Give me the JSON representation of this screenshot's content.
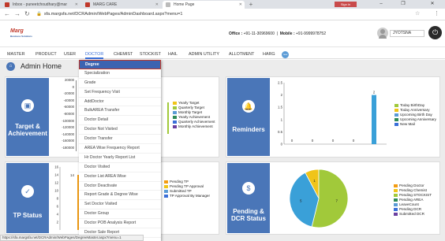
{
  "browser": {
    "tabs": [
      {
        "label": "Inbox - puneetchoudhary@mar",
        "icon_color": "#c0392b"
      },
      {
        "label": "MARG CARE",
        "icon_color": "#c0392b"
      },
      {
        "label": "Home Page",
        "icon_color": "#999999"
      }
    ],
    "new_tab": "+",
    "signin": "Sign in",
    "url": "sfa.margsfa.net/DCRAdmin/WebPages/AdminDashboard.aspx?menu=1"
  },
  "header": {
    "logo": "Marg",
    "logo_sub": "Business Solutions",
    "office_label": "Office :",
    "office_phone": "+91-11-30969600",
    "mobile_label": "Mobile :",
    "mobile_phone": "+91-9999978752",
    "username": "JYOTSNA"
  },
  "menu": [
    "MASTER",
    "PRODUCT",
    "USER",
    "DOCTOR",
    "CHEMIST",
    "STOCKIST",
    "HAIL",
    "ADMIN UTILITY",
    "ALLOTMENT",
    "HARG"
  ],
  "new_badge": "new",
  "page": {
    "title": "Admin Home"
  },
  "dropdown": [
    "Degree",
    "Specialization",
    "Grade",
    "Set Frequency Visit",
    "AddDoctor",
    "BulkAREA Transfer",
    "Doctor Detail",
    "Doctor Not Visited",
    "Doctor Transfer",
    "AREA Wise Frequency Report",
    "Hr Doctor Yearly Report List",
    "Doctor Visited",
    "Doctor List AREA Wise",
    "Doctor Deactivate",
    "Report Grade & Degree Wise",
    "Set Doctor Visited",
    "Doctor Group",
    "Doctor POB Analysis Report",
    "Doctor Sale Report"
  ],
  "target": {
    "title": "Target &",
    "title2": "Achievement",
    "y_ticks": [
      "20000",
      "0",
      "-20000",
      "-40000",
      "-60000",
      "-80000",
      "-100000",
      "-120000",
      "-140000",
      "-160000",
      "-180000"
    ],
    "legend": [
      {
        "label": "Yearly Target",
        "color": "#f0c419"
      },
      {
        "label": "Quarterly Target",
        "color": "#a1c93a"
      },
      {
        "label": "Monthly Target",
        "color": "#5b9bd5"
      },
      {
        "label": "Yearly Achievement",
        "color": "#2e8b57"
      },
      {
        "label": "Quarterly Achievement",
        "color": "#3a6fd8"
      },
      {
        "label": "Monthly Achievement",
        "color": "#6b3fa0"
      }
    ]
  },
  "reminders": {
    "title": "Reminders",
    "y_ticks": [
      "2.5",
      "2",
      "1.5",
      "1",
      "0.5",
      "0"
    ],
    "bar_value_label": "2",
    "zero_labels": [
      "0",
      "0",
      "0",
      "0"
    ],
    "legend": [
      {
        "label": "Today BirthDay",
        "color": "#a1c93a"
      },
      {
        "label": "Today Anniversary",
        "color": "#f0c419"
      },
      {
        "label": "Upcoming Birth Day",
        "color": "#5b9bd5"
      },
      {
        "label": "Upcoming Anniversary",
        "color": "#2e8b57"
      },
      {
        "label": "New Mail",
        "color": "#3a6fd8"
      }
    ]
  },
  "tp": {
    "title": "TP Status",
    "y_ticks": [
      "16",
      "14",
      "12",
      "10",
      "8",
      "6",
      "4",
      "2"
    ],
    "bar_value_label": "14",
    "legend": [
      {
        "label": "Pending TP",
        "color": "#f39c12"
      },
      {
        "label": "Pending TP Approval",
        "color": "#f0c419"
      },
      {
        "label": "Submitted TP",
        "color": "#5b9bd5"
      },
      {
        "label": "TP Approval By Manager",
        "color": "#3a6fd8"
      }
    ]
  },
  "pending": {
    "title": "Pending &",
    "title2": "DCR Status",
    "slice_labels": [
      "7",
      "5",
      "1"
    ],
    "legend": [
      {
        "label": "Pending Doctor",
        "color": "#f39c12"
      },
      {
        "label": "Pending Chemist",
        "color": "#f0c419"
      },
      {
        "label": "Pending STOCKIST",
        "color": "#a1c93a"
      },
      {
        "label": "Pending AREA",
        "color": "#2e8b57"
      },
      {
        "label": "LeaveCount",
        "color": "#5b9bd5"
      },
      {
        "label": "Pending DCR",
        "color": "#3a6fd8"
      },
      {
        "label": "Submitted DCR",
        "color": "#6b3fa0"
      }
    ]
  },
  "chart_data": [
    {
      "type": "bar",
      "title": "Reminders",
      "categories": [
        "Today BirthDay",
        "Today Anniversary",
        "Upcoming Birth Day",
        "Upcoming Anniversary",
        "New Mail"
      ],
      "values": [
        0,
        0,
        0,
        0,
        2
      ],
      "ylim": [
        0,
        2.5
      ]
    },
    {
      "type": "bar",
      "title": "TP Status",
      "series": [
        {
          "name": "Pending TP",
          "values": [
            14
          ]
        }
      ],
      "ylim": [
        0,
        16
      ]
    },
    {
      "type": "pie",
      "title": "Pending & DCR Status",
      "series": [
        {
          "name": "Pending STOCKIST",
          "values": [
            1
          ]
        },
        {
          "name": "Pending AREA",
          "values": [
            7
          ]
        },
        {
          "name": "LeaveCount",
          "values": [
            5
          ]
        }
      ]
    }
  ],
  "status_url": "https://sfa.margsfa.net/DCRAdmin/WebPages/DegreeMaster.aspx?menu=1"
}
